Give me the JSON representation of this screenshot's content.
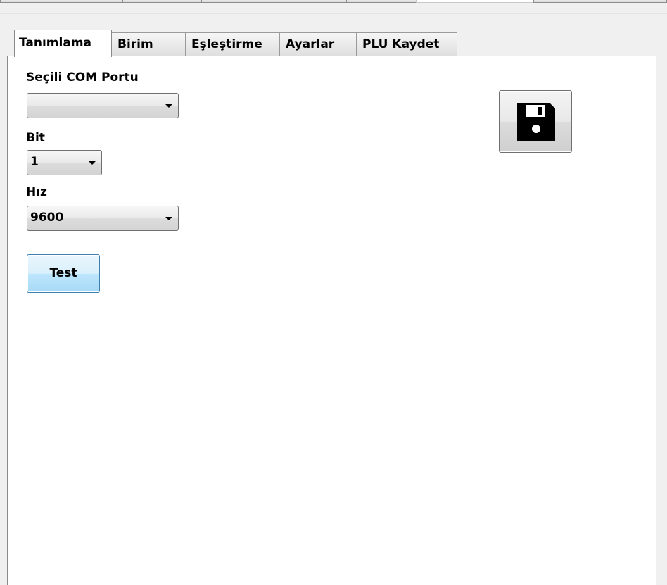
{
  "tabs": [
    {
      "label": "Tanımlama",
      "active": true
    },
    {
      "label": "Birim",
      "active": false
    },
    {
      "label": "Eşleştirme",
      "active": false
    },
    {
      "label": "Ayarlar",
      "active": false
    },
    {
      "label": "PLU Kaydet",
      "active": false
    }
  ],
  "form": {
    "com_port_label": "Seçili COM Portu",
    "com_port_value": "",
    "bit_label": "Bit",
    "bit_value": "1",
    "speed_label": "Hız",
    "speed_value": "9600",
    "test_button_label": "Test"
  },
  "toolbar": {
    "save_icon": "floppy-disk-icon"
  },
  "colors": {
    "panel_background": "#ffffff",
    "window_background": "#f0f0f0",
    "test_button_border": "#3c7fb1"
  }
}
